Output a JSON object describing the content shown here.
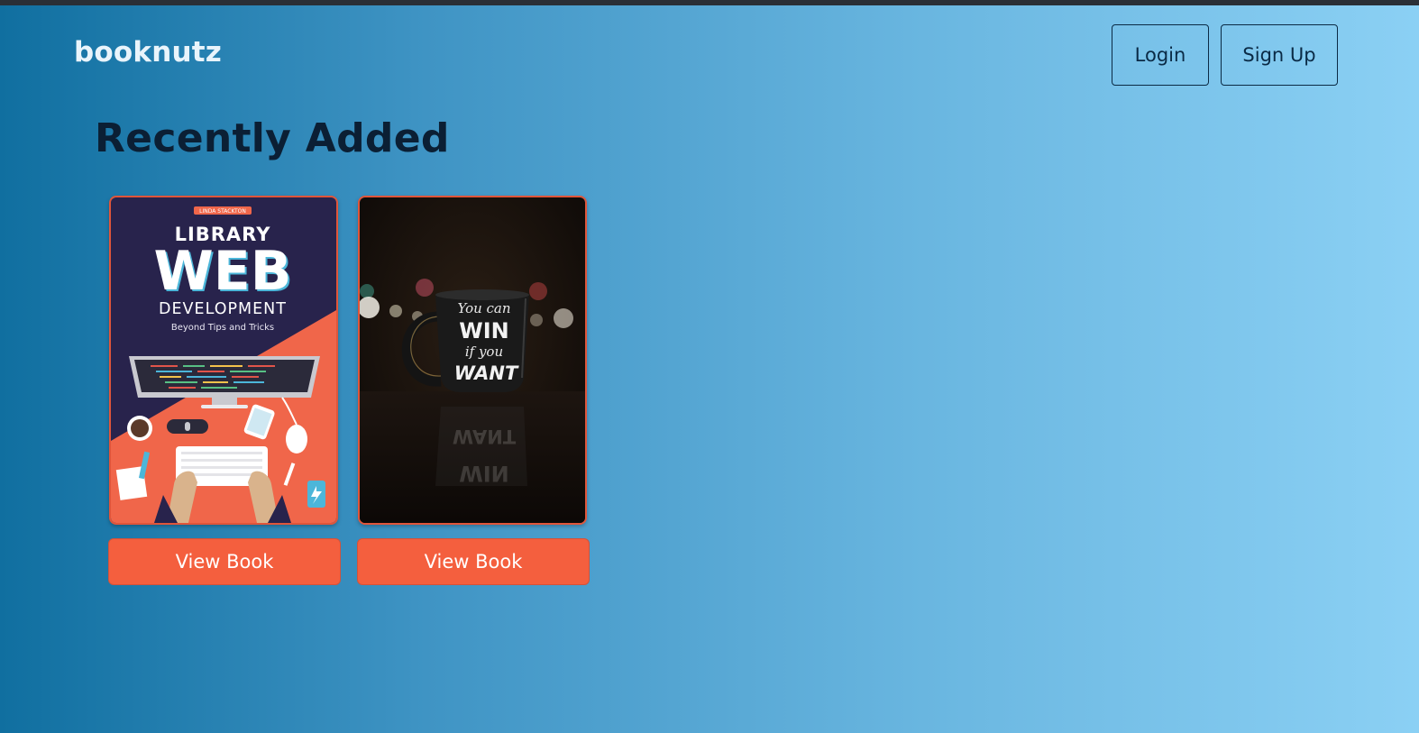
{
  "header": {
    "brand": "booknutz",
    "login_label": "Login",
    "signup_label": "Sign Up"
  },
  "main": {
    "heading": "Recently Added",
    "books": [
      {
        "cover_top_tag": "LINDA STACKTON",
        "cover_title_line1": "LIBRARY",
        "cover_title_line2": "WEB",
        "cover_title_line3": "DEVELOPMENT",
        "cover_subtitle": "Beyond Tips and Tricks",
        "button_label": "View Book"
      },
      {
        "cover_text_line1": "You can",
        "cover_text_line2": "WIN",
        "cover_text_line3": "if you",
        "cover_text_line4": "WANT",
        "button_label": "View Book"
      }
    ]
  },
  "colors": {
    "accent": "#f45f3e",
    "navy": "#28234c",
    "coral": "#f0664a"
  }
}
